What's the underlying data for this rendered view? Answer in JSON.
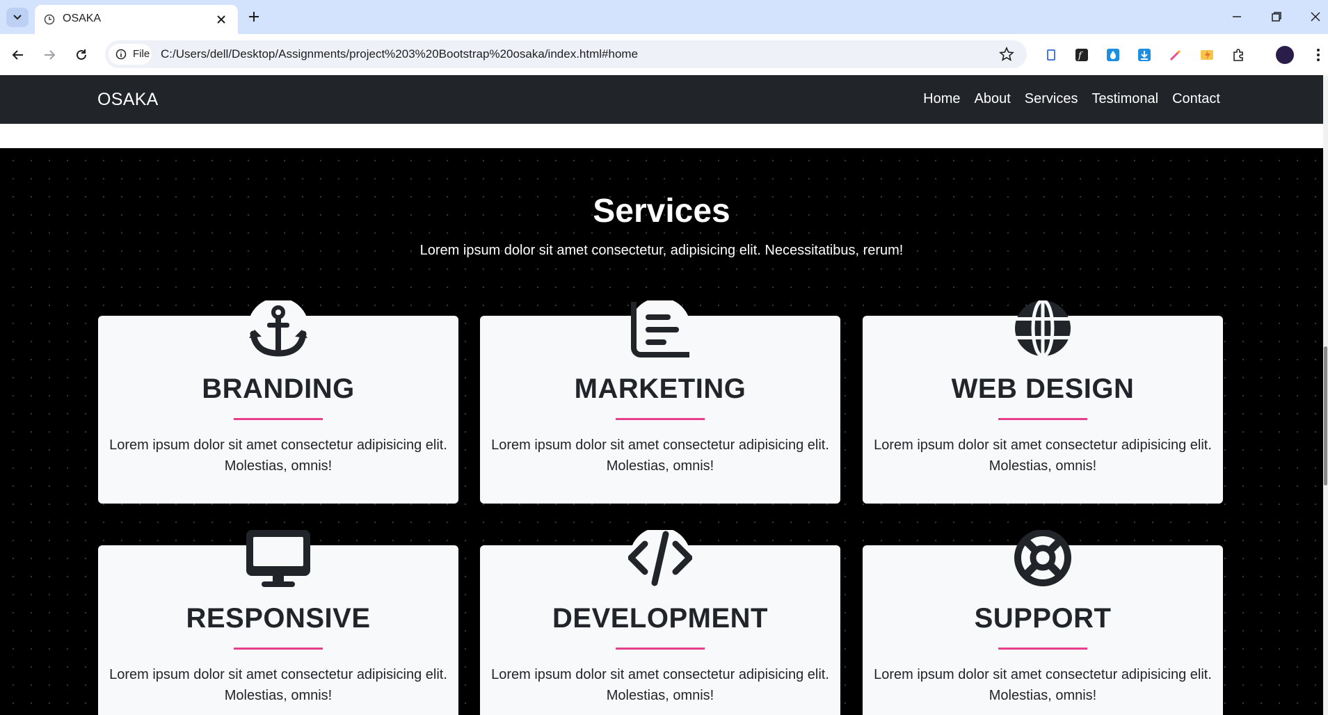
{
  "browser": {
    "tab_title": "OSAKA",
    "site_chip_label": "File",
    "url": "C:/Users/dell/Desktop/Assignments/project%203%20Bootstrap%20osaka/index.html#home"
  },
  "navbar": {
    "brand": "OSAKA",
    "links": [
      "Home",
      "About",
      "Services",
      "Testimonal",
      "Contact"
    ]
  },
  "services": {
    "title": "Services",
    "subtitle": "Lorem ipsum dolor sit amet consectetur, adipisicing elit. Necessitatibus, rerum!",
    "cards": [
      {
        "icon": "anchor-icon",
        "title": "BRANDING",
        "text": "Lorem ipsum dolor sit amet consectetur adipisicing elit. Molestias, omnis!"
      },
      {
        "icon": "book-icon",
        "title": "MARKETING",
        "text": "Lorem ipsum dolor sit amet consectetur adipisicing elit. Molestias, omnis!"
      },
      {
        "icon": "globe-icon",
        "title": "WEB DESIGN",
        "text": "Lorem ipsum dolor sit amet consectetur adipisicing elit. Molestias, omnis!"
      },
      {
        "icon": "monitor-icon",
        "title": "RESPONSIVE",
        "text": "Lorem ipsum dolor sit amet consectetur adipisicing elit. Molestias, omnis!"
      },
      {
        "icon": "code-icon",
        "title": "DEVELOPMENT",
        "text": "Lorem ipsum dolor sit amet consectetur adipisicing elit. Molestias, omnis!"
      },
      {
        "icon": "lifebuoy-icon",
        "title": "SUPPORT",
        "text": "Lorem ipsum dolor sit amet consectetur adipisicing elit. Molestias, omnis!"
      }
    ]
  },
  "colors": {
    "accent": "#e83e8c",
    "navbar_bg": "#212529",
    "card_bg": "#f8f9fa"
  }
}
